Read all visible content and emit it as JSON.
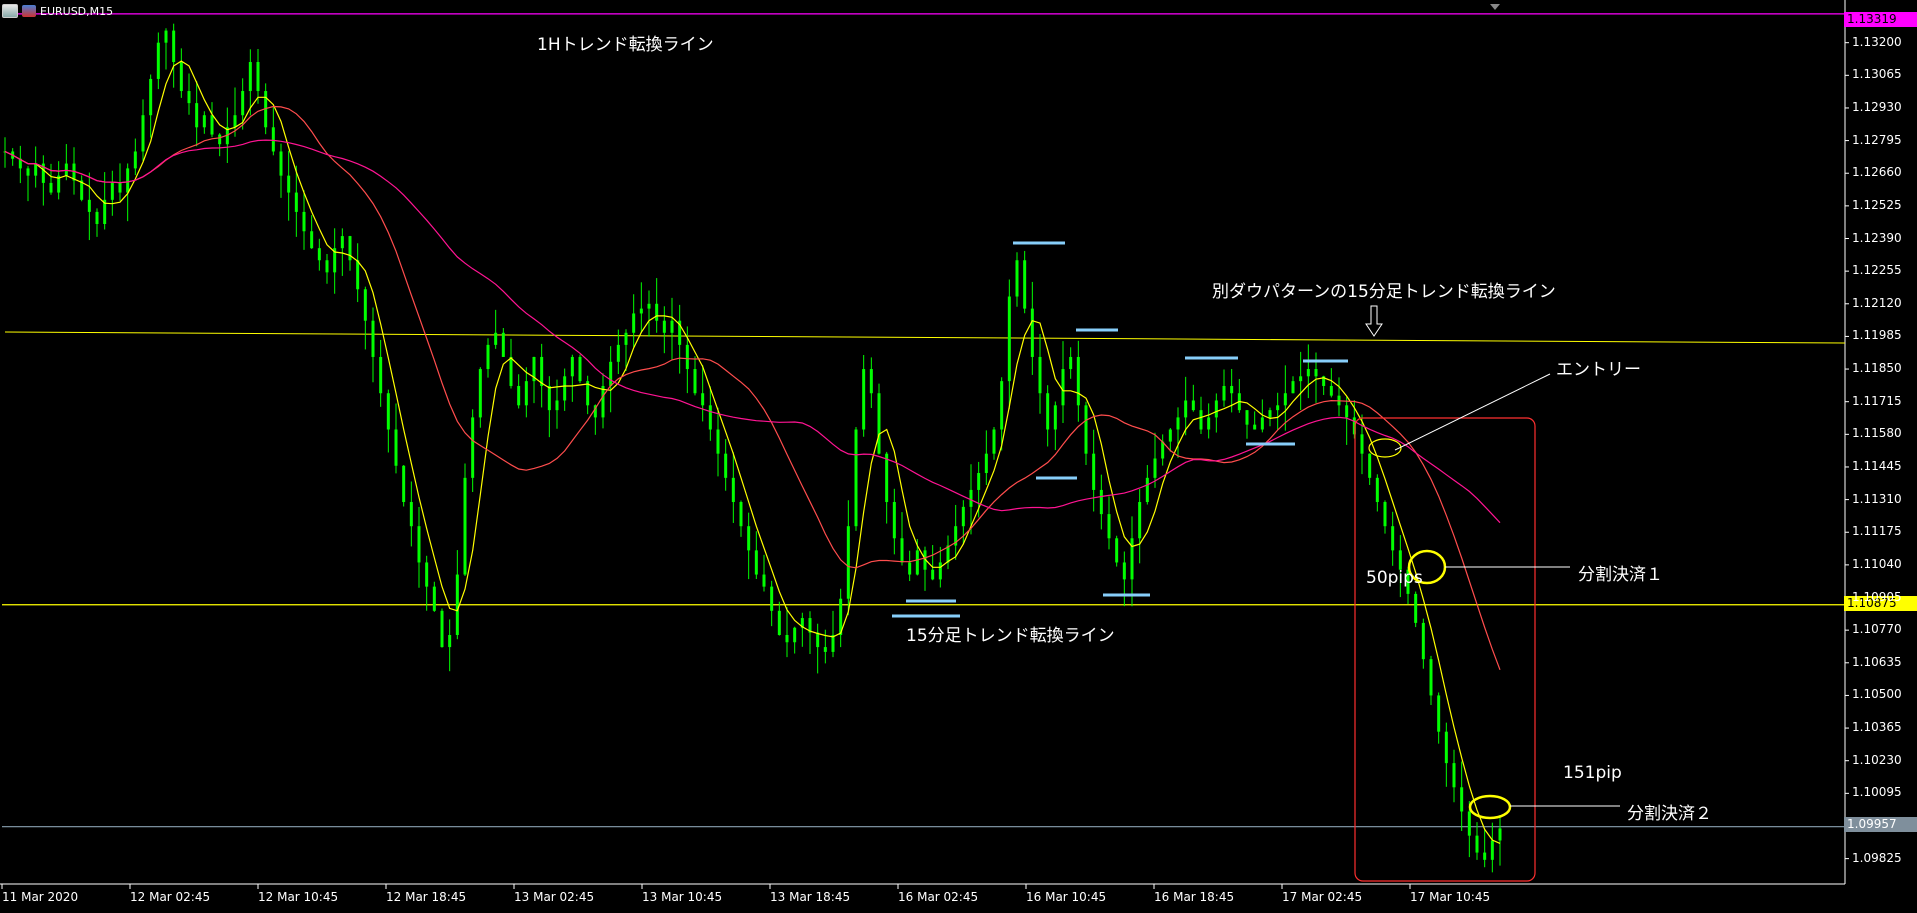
{
  "symbol_label": "EURUSD,M15",
  "annotations": {
    "trend_line_1h": "1Hトレンド転換ライン",
    "trend_line_15m_alt": "別ダウパターンの15分足トレンド転換ライン",
    "entry": "エントリー",
    "partial_close_1": "分割決済１",
    "partial_close_2": "分割決済２",
    "pips_50": "50pips",
    "pips_151": "151pip",
    "trend_line_15m": "15分足トレンド転換ライン"
  },
  "price_tags": {
    "top_line": "1.13319",
    "support_line": "1.10875",
    "current": "1.09957"
  },
  "colors": {
    "background": "#000000",
    "candle": "#00ff00",
    "ma_fast": "#ffff00",
    "ma_mid": "#ff4d4d",
    "ma_slow": "#ff1493",
    "magenta_line": "#ff00ff",
    "horizontal_line": "#ffff00",
    "marker": "#87cefa",
    "entry_box": "#ff3030"
  },
  "chart_data": {
    "type": "candlestick",
    "symbol": "EURUSD",
    "timeframe": "M15",
    "ylim": [
      1.0972,
      1.1336
    ],
    "price_ticks": [
      "1.13200",
      "1.13065",
      "1.12930",
      "1.12795",
      "1.12660",
      "1.12525",
      "1.12390",
      "1.12255",
      "1.12120",
      "1.11985",
      "1.11850",
      "1.11715",
      "1.11580",
      "1.11445",
      "1.11310",
      "1.11175",
      "1.11040",
      "1.10905",
      "1.10770",
      "1.10635",
      "1.10500",
      "1.10365",
      "1.10230",
      "1.10095",
      "1.09825"
    ],
    "time_labels": [
      "11 Mar 2020",
      "12 Mar 02:45",
      "12 Mar 10:45",
      "12 Mar 18:45",
      "13 Mar 02:45",
      "13 Mar 10:45",
      "13 Mar 18:45",
      "16 Mar 02:45",
      "16 Mar 10:45",
      "16 Mar 18:45",
      "17 Mar 02:45",
      "17 Mar 10:45"
    ],
    "horizontal_levels": [
      {
        "price": 1.13319,
        "color": "#ff00ff"
      },
      {
        "price": 1.10875,
        "color": "#ffff00"
      },
      {
        "price": 1.09957,
        "color": "#8aa1b1"
      }
    ],
    "close_path": [
      1.1275,
      1.1272,
      1.1268,
      1.1265,
      1.127,
      1.1262,
      1.1258,
      1.1265,
      1.127,
      1.1263,
      1.1255,
      1.125,
      1.1245,
      1.1255,
      1.1262,
      1.1258,
      1.1268,
      1.1275,
      1.129,
      1.1305,
      1.132,
      1.1325,
      1.1312,
      1.13,
      1.1295,
      1.1285,
      1.129,
      1.1282,
      1.1278,
      1.1285,
      1.129,
      1.13,
      1.1312,
      1.13,
      1.1285,
      1.1275,
      1.1265,
      1.1258,
      1.125,
      1.1242,
      1.1235,
      1.123,
      1.1225,
      1.1235,
      1.124,
      1.123,
      1.1218,
      1.1205,
      1.119,
      1.1175,
      1.116,
      1.1145,
      1.113,
      1.112,
      1.1105,
      1.1095,
      1.1085,
      1.107,
      1.1075,
      1.11,
      1.114,
      1.1165,
      1.1185,
      1.1195,
      1.12,
      1.119,
      1.1178,
      1.117,
      1.118,
      1.119,
      1.1178,
      1.1168,
      1.1172,
      1.1182,
      1.119,
      1.118,
      1.117,
      1.1165,
      1.1178,
      1.1188,
      1.1195,
      1.12,
      1.1208,
      1.121,
      1.1212,
      1.1205,
      1.12,
      1.1205,
      1.1195,
      1.1185,
      1.1175,
      1.117,
      1.116,
      1.115,
      1.114,
      1.113,
      1.112,
      1.111,
      1.11,
      1.1095,
      1.1085,
      1.1075,
      1.1072,
      1.1078,
      1.1082,
      1.1076,
      1.107,
      1.1068,
      1.1075,
      1.109,
      1.112,
      1.116,
      1.1185,
      1.1175,
      1.115,
      1.113,
      1.1115,
      1.1105,
      1.11,
      1.111,
      1.1102,
      1.1098,
      1.1105,
      1.1112,
      1.112,
      1.1128,
      1.1135,
      1.1142,
      1.115,
      1.116,
      1.118,
      1.1215,
      1.123,
      1.121,
      1.119,
      1.1175,
      1.116,
      1.117,
      1.1185,
      1.119,
      1.117,
      1.115,
      1.1135,
      1.1125,
      1.1115,
      1.1105,
      1.1098,
      1.1115,
      1.113,
      1.114,
      1.1148,
      1.1155,
      1.116,
      1.1165,
      1.1172,
      1.1168,
      1.116,
      1.1165,
      1.1172,
      1.1178,
      1.1175,
      1.1168,
      1.1162,
      1.116,
      1.1165,
      1.1168,
      1.117,
      1.1175,
      1.118,
      1.1182,
      1.1185,
      1.1182,
      1.1178,
      1.1174,
      1.117,
      1.1165,
      1.1158,
      1.115,
      1.114,
      1.113,
      1.112,
      1.111,
      1.1102,
      1.1092,
      1.108,
      1.1065,
      1.105,
      1.1035,
      1.1022,
      1.1012,
      1.1002,
      1.0992,
      1.0985,
      1.0982,
      1.099,
      1.0995
    ]
  }
}
